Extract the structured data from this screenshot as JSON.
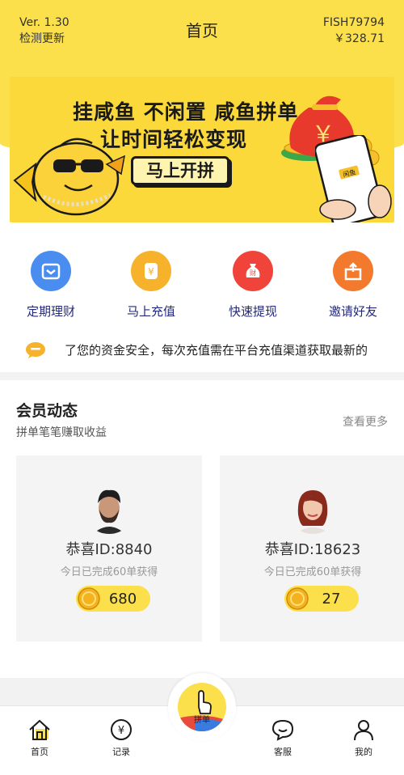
{
  "header": {
    "version": "Ver. 1.30",
    "check_update": "检测更新",
    "title": "首页",
    "username": "FISH79794",
    "balance": "￥328.71"
  },
  "banner": {
    "line1": "挂咸鱼 不闲置 咸鱼拼单",
    "line2": "让时间轻松变现",
    "button": "马上开拼",
    "money_bag_symbol": "￥",
    "phone_label": "闲鱼"
  },
  "menu": [
    {
      "label": "定期理财",
      "icon": "wallet-icon",
      "color": "#4a8df0"
    },
    {
      "label": "马上充值",
      "icon": "recharge-coin-icon",
      "color": "#f6b22a"
    },
    {
      "label": "快速提现",
      "icon": "money-bag-icon",
      "color": "#f0443a"
    },
    {
      "label": "邀请好友",
      "icon": "gift-box-icon",
      "color": "#f37a2c"
    }
  ],
  "notice": {
    "text": "了您的资金安全，每次充值需在平台充值渠道获取最新的"
  },
  "members": {
    "title": "会员动态",
    "subtitle": "拼单笔笔赚取收益",
    "more": "查看更多",
    "cards": [
      {
        "id_text": "恭喜ID:8840",
        "desc": "今日已完成60单获得",
        "amount": "680"
      },
      {
        "id_text": "恭喜ID:18623",
        "desc": "今日已完成60单获得",
        "amount": "27"
      }
    ]
  },
  "nav": {
    "home": "首页",
    "records": "记录",
    "center": "拼单",
    "service": "客服",
    "mine": "我的"
  },
  "colors": {
    "brand_yellow": "#fbe04b",
    "menu_text": "#23297a"
  }
}
